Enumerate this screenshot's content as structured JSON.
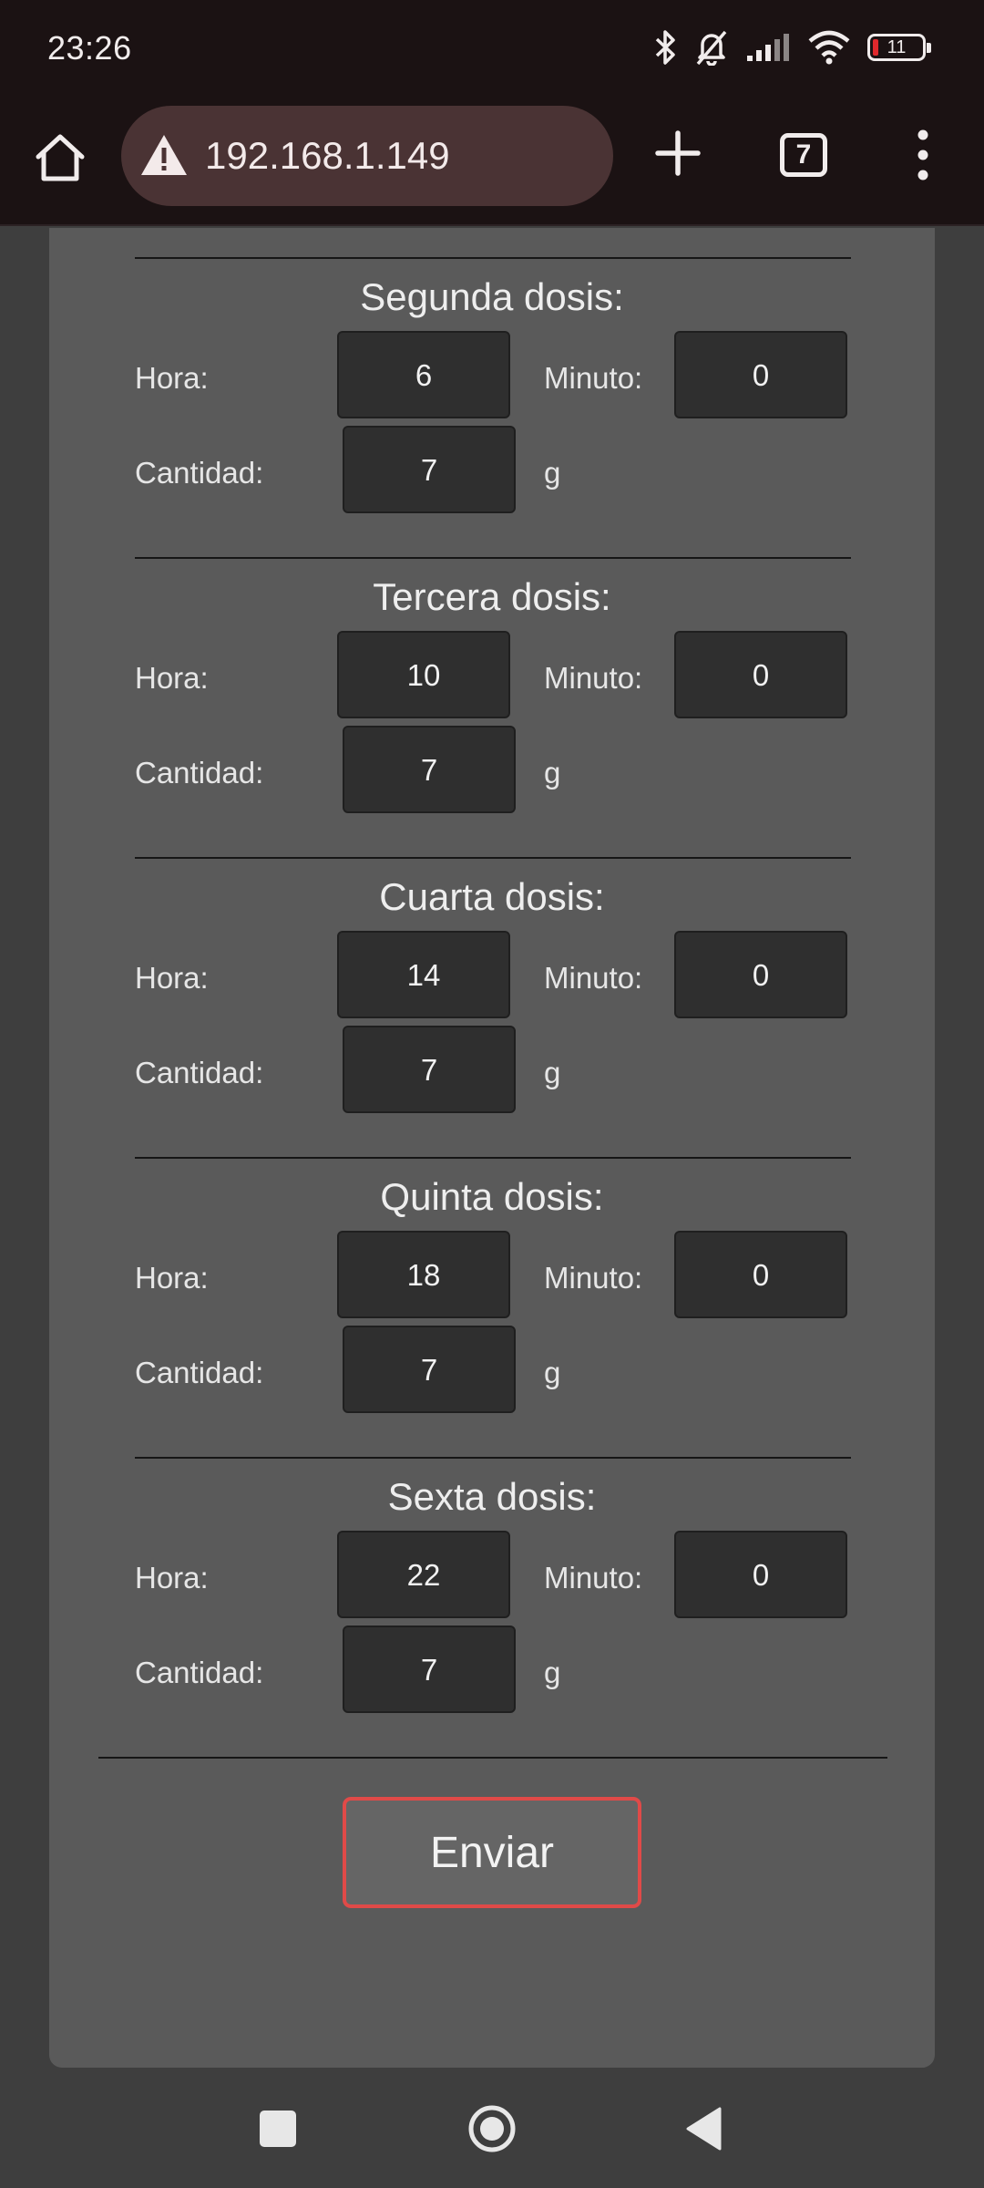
{
  "status_bar": {
    "time": "23:26",
    "battery": "11",
    "icons": [
      "bluetooth-icon",
      "bell-off-icon",
      "signal-icon",
      "wifi-icon",
      "battery-icon"
    ]
  },
  "browser": {
    "url": "192.168.1.149",
    "tab_count": "7",
    "icons": [
      "home-icon",
      "warning-icon",
      "plus-icon",
      "tabs-icon",
      "more-vert-icon"
    ]
  },
  "form": {
    "labels": {
      "hour": "Hora:",
      "minute": "Minuto:",
      "amount": "Cantidad:",
      "unit": "g"
    },
    "doses": [
      {
        "title": "Segunda dosis:",
        "hour": "6",
        "minute": "0",
        "amount": "7"
      },
      {
        "title": "Tercera dosis:",
        "hour": "10",
        "minute": "0",
        "amount": "7"
      },
      {
        "title": "Cuarta dosis:",
        "hour": "14",
        "minute": "0",
        "amount": "7"
      },
      {
        "title": "Quinta dosis:",
        "hour": "18",
        "minute": "0",
        "amount": "7"
      },
      {
        "title": "Sexta dosis:",
        "hour": "22",
        "minute": "0",
        "amount": "7"
      }
    ],
    "submit_label": "Enviar",
    "accent_color": "#e04a48"
  },
  "nav_bar": {
    "icons": [
      "recents-icon",
      "home-circle-icon",
      "back-icon"
    ]
  }
}
